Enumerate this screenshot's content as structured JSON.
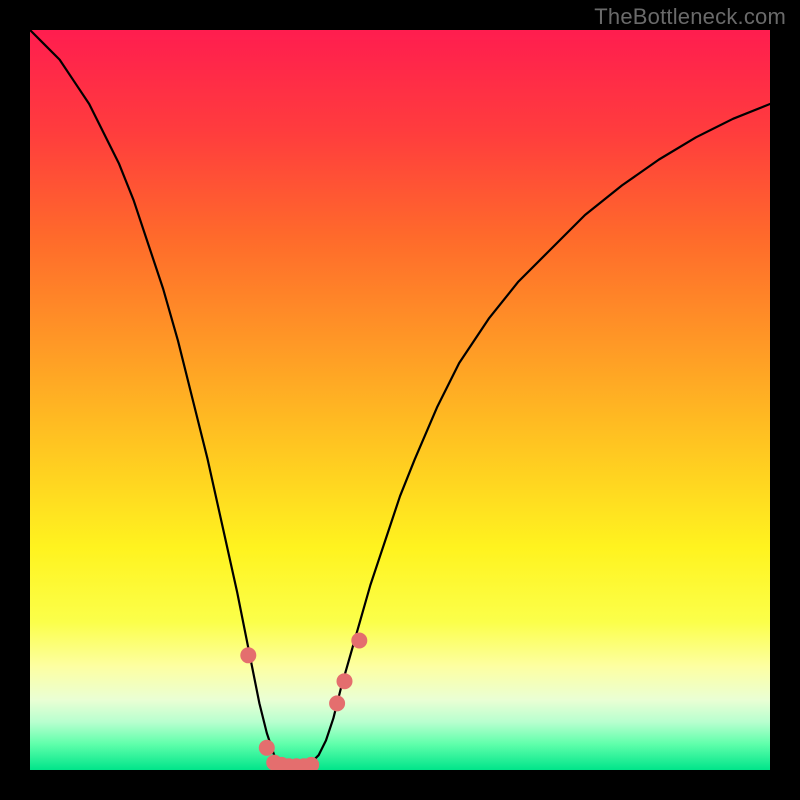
{
  "watermark": "TheBottleneck.com",
  "colors": {
    "frame": "#000000",
    "watermark_text": "#6a6a6a",
    "curve": "#000000",
    "marker_fill": "#e46e6e",
    "marker_stroke": "#d65a5a",
    "gradient_stops": [
      {
        "offset": 0.0,
        "color": "#ff1d4f"
      },
      {
        "offset": 0.14,
        "color": "#ff3d3d"
      },
      {
        "offset": 0.28,
        "color": "#ff6a2b"
      },
      {
        "offset": 0.42,
        "color": "#ff9726"
      },
      {
        "offset": 0.56,
        "color": "#ffc521"
      },
      {
        "offset": 0.7,
        "color": "#fff31f"
      },
      {
        "offset": 0.8,
        "color": "#fbff4a"
      },
      {
        "offset": 0.86,
        "color": "#fdffa2"
      },
      {
        "offset": 0.905,
        "color": "#eaffd4"
      },
      {
        "offset": 0.935,
        "color": "#b8ffcf"
      },
      {
        "offset": 0.965,
        "color": "#5fffab"
      },
      {
        "offset": 1.0,
        "color": "#00e58a"
      }
    ]
  },
  "chart_data": {
    "type": "line",
    "title": "",
    "xlabel": "",
    "ylabel": "",
    "xrange": [
      0,
      100
    ],
    "ylim": [
      0,
      100
    ],
    "grid": false,
    "series": [
      {
        "name": "bottleneck-curve",
        "x": [
          0,
          2,
          4,
          6,
          8,
          10,
          12,
          14,
          16,
          18,
          20,
          22,
          24,
          26,
          28,
          30,
          31,
          32,
          33,
          34,
          35,
          36,
          37,
          38,
          39,
          40,
          41,
          42,
          44,
          46,
          48,
          50,
          52,
          55,
          58,
          62,
          66,
          70,
          75,
          80,
          85,
          90,
          95,
          100
        ],
        "y": [
          100,
          98,
          96,
          93,
          90,
          86,
          82,
          77,
          71,
          65,
          58,
          50,
          42,
          33,
          24,
          14,
          9,
          5,
          2,
          1,
          0.5,
          0.5,
          0.5,
          1,
          2,
          4,
          7,
          11,
          18,
          25,
          31,
          37,
          42,
          49,
          55,
          61,
          66,
          70,
          75,
          79,
          82.5,
          85.5,
          88,
          90
        ]
      }
    ],
    "markers": {
      "name": "highlight-points",
      "x": [
        29.5,
        32.0,
        33.0,
        34.0,
        35.0,
        36.0,
        37.0,
        38.0,
        41.5,
        42.5,
        44.5
      ],
      "y": [
        15.5,
        3.0,
        1.0,
        0.7,
        0.5,
        0.5,
        0.5,
        0.7,
        9.0,
        12.0,
        17.5
      ]
    },
    "annotations": []
  }
}
